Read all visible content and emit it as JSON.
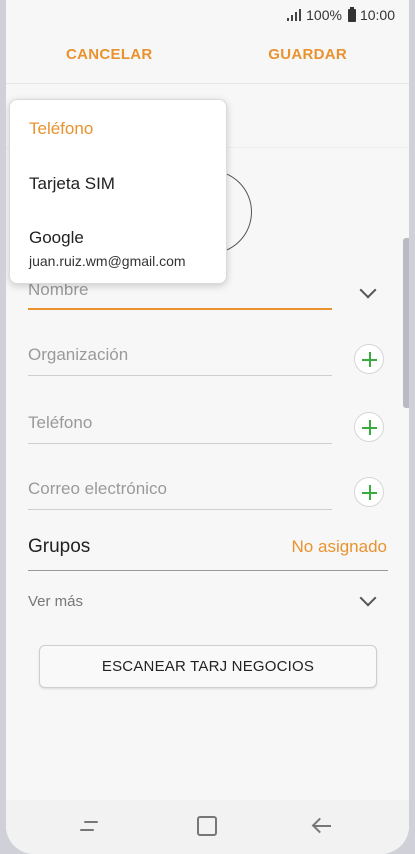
{
  "status_bar": {
    "battery_percent": "100%",
    "time": "10:00",
    "signal_icon": "signal-icon",
    "battery_icon": "battery-icon"
  },
  "toolbar": {
    "cancel_label": "CANCELAR",
    "save_label": "GUARDAR"
  },
  "storage_dropdown": {
    "items": [
      {
        "label": "Teléfono",
        "selected": true
      },
      {
        "label": "Tarjeta SIM",
        "selected": false
      },
      {
        "label": "Google",
        "sublabel": "juan.ruiz.wm@gmail.com",
        "selected": false
      }
    ]
  },
  "form": {
    "name_placeholder": "Nombre",
    "organization_placeholder": "Organización",
    "phone_placeholder": "Teléfono",
    "email_placeholder": "Correo electrónico",
    "groups_label": "Grupos",
    "groups_value": "No asignado",
    "more_label": "Ver más",
    "scan_button_label": "ESCANEAR TARJ NEGOCIOS"
  },
  "colors": {
    "accent": "#e8932f",
    "add_green": "#3aab3e"
  }
}
